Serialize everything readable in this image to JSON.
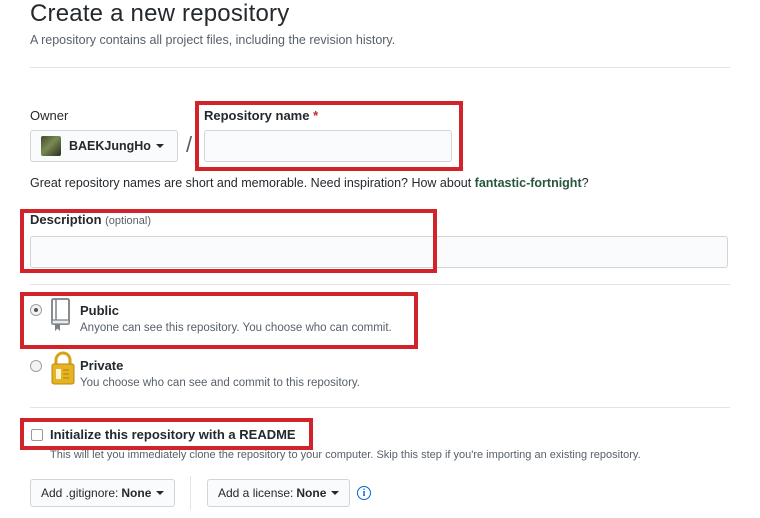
{
  "header": {
    "title": "Create a new repository",
    "subtitle": "A repository contains all project files, including the revision history."
  },
  "owner": {
    "label": "Owner",
    "name": "BAEKJungHo"
  },
  "repo_name": {
    "label": "Repository name",
    "required_mark": "*",
    "value": "",
    "slash": "/"
  },
  "hint": {
    "text": "Great repository names are short and memorable. Need inspiration? How about ",
    "suggestion": "fantastic-fortnight",
    "end": "?"
  },
  "description": {
    "label": "Description",
    "optional": "(optional)",
    "value": ""
  },
  "visibility": {
    "selected": "public",
    "public": {
      "title": "Public",
      "desc": "Anyone can see this repository. You choose who can commit."
    },
    "private": {
      "title": "Private",
      "desc": "You choose who can see and commit to this repository."
    }
  },
  "readme": {
    "label": "Initialize this repository with a README",
    "checked": false,
    "desc": "This will let you immediately clone the repository to your computer. Skip this step if you're importing an existing repository."
  },
  "gitignore": {
    "prefix": "Add .gitignore:",
    "value": "None"
  },
  "license": {
    "prefix": "Add a license:",
    "value": "None"
  },
  "colors": {
    "highlight": "#d2232a",
    "link_green": "#28553d",
    "info_blue": "#0366d6"
  },
  "icons": [
    "repo-public-icon",
    "lock-icon",
    "info-icon",
    "caret-down-icon"
  ]
}
